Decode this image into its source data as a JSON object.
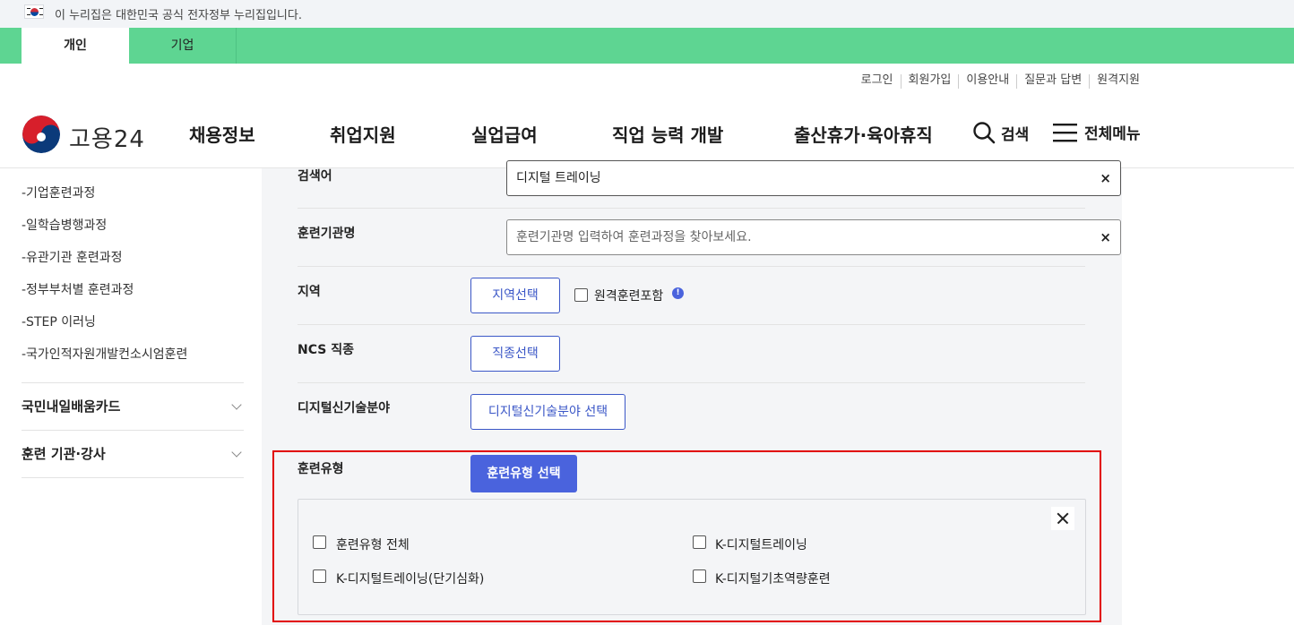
{
  "gov_banner": {
    "text": "이 누리집은 대한민국 공식 전자정부 누리집입니다."
  },
  "user_tabs": [
    {
      "label": "개인",
      "active": true
    },
    {
      "label": "기업",
      "active": false
    }
  ],
  "util_links": [
    "로그인",
    "회원가입",
    "이용안내",
    "질문과 답변",
    "원격지원"
  ],
  "header": {
    "logo_text": "고용24",
    "gnb": [
      "채용정보",
      "취업지원",
      "실업급여",
      "직업 능력 개발",
      "출산휴가·육아휴직"
    ],
    "search_label": "검색",
    "menu_label": "전체메뉴"
  },
  "lnb": {
    "sub_items": [
      "-기업훈련과정",
      "-일학습병행과정",
      "-유관기관 훈련과정",
      "-정부부처별 훈련과정",
      "-STEP 이러닝",
      "-국가인적자원개발컨소시엄훈련"
    ],
    "main_items": [
      "국민내일배움카드",
      "훈련 기관·강사"
    ]
  },
  "form": {
    "keyword": {
      "label": "검색어",
      "value": "디지털 트레이닝",
      "clear": "×"
    },
    "institution": {
      "label": "훈련기관명",
      "placeholder": "훈련기관명 입력하여 훈련과정을 찾아보세요.",
      "clear": "×"
    },
    "region": {
      "label": "지역",
      "button": "지역선택",
      "remote_checkbox": "원격훈련포함",
      "info": "!"
    },
    "ncs": {
      "label": "NCS 직종",
      "button": "직종선택"
    },
    "digital": {
      "label": "디지털신기술분야",
      "button": "디지털신기술분야 선택"
    },
    "training_type": {
      "label": "훈련유형",
      "button": "훈련유형 선택",
      "options": [
        "훈련유형 전체",
        "K-디지털트레이닝",
        "K-디지털트레이닝(단기심화)",
        "K-디지털기초역량훈련"
      ]
    }
  },
  "colors": {
    "green_bar": "#5ed592",
    "primary": "#4a63dd",
    "highlight": "#e10000"
  }
}
